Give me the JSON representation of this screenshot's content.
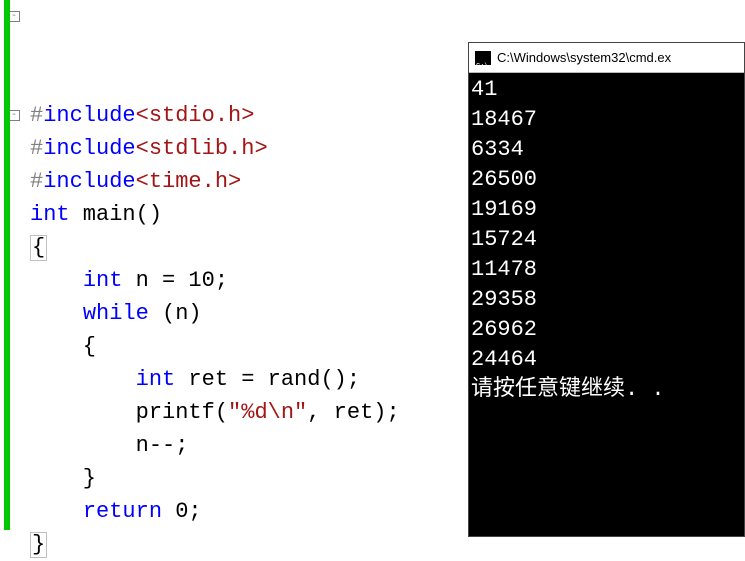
{
  "editor": {
    "lines": [
      {
        "fold": "-",
        "tokens": [
          {
            "cls": "kw-pre",
            "t": "#"
          },
          {
            "cls": "kw-inc",
            "t": "include"
          },
          {
            "cls": "kw-hdr",
            "t": "<stdio.h>"
          }
        ]
      },
      {
        "fold": "",
        "tokens": [
          {
            "cls": "kw-pre",
            "t": "#"
          },
          {
            "cls": "kw-inc",
            "t": "include"
          },
          {
            "cls": "kw-hdr",
            "t": "<stdlib.h>"
          }
        ]
      },
      {
        "fold": "",
        "tokens": [
          {
            "cls": "kw-pre",
            "t": "#"
          },
          {
            "cls": "kw-inc",
            "t": "include"
          },
          {
            "cls": "kw-hdr",
            "t": "<time.h>"
          }
        ]
      },
      {
        "fold": "-",
        "tokens": [
          {
            "cls": "kw-type",
            "t": "int"
          },
          {
            "cls": "plain",
            "t": " main()"
          }
        ]
      },
      {
        "fold": "",
        "tokens": [
          {
            "cls": "plain",
            "t": "{",
            "hl": true
          }
        ]
      },
      {
        "fold": "",
        "tokens": [
          {
            "cls": "plain",
            "t": "    "
          },
          {
            "cls": "kw-type",
            "t": "int"
          },
          {
            "cls": "plain",
            "t": " n = 10;"
          }
        ]
      },
      {
        "fold": "",
        "tokens": [
          {
            "cls": "plain",
            "t": "    "
          },
          {
            "cls": "kw-type",
            "t": "while"
          },
          {
            "cls": "plain",
            "t": " (n)"
          }
        ]
      },
      {
        "fold": "",
        "tokens": [
          {
            "cls": "plain",
            "t": "    {"
          }
        ]
      },
      {
        "fold": "",
        "tokens": [
          {
            "cls": "plain",
            "t": "        "
          },
          {
            "cls": "kw-type",
            "t": "int"
          },
          {
            "cls": "plain",
            "t": " ret = rand();"
          }
        ]
      },
      {
        "fold": "",
        "tokens": [
          {
            "cls": "plain",
            "t": "        printf("
          },
          {
            "cls": "kw-str",
            "t": "\"%d\\n\""
          },
          {
            "cls": "plain",
            "t": ", ret);"
          }
        ]
      },
      {
        "fold": "",
        "tokens": [
          {
            "cls": "plain",
            "t": "        n--;"
          }
        ]
      },
      {
        "fold": "",
        "tokens": [
          {
            "cls": "plain",
            "t": "    }"
          }
        ]
      },
      {
        "fold": "",
        "tokens": [
          {
            "cls": "plain",
            "t": "    "
          },
          {
            "cls": "kw-type",
            "t": "return"
          },
          {
            "cls": "plain",
            "t": " 0;"
          }
        ]
      },
      {
        "fold": "",
        "tokens": [
          {
            "cls": "plain",
            "t": "}",
            "hl": true
          }
        ]
      }
    ]
  },
  "console": {
    "title": "C:\\Windows\\system32\\cmd.ex",
    "output": [
      "41",
      "18467",
      "6334",
      "26500",
      "19169",
      "15724",
      "11478",
      "29358",
      "26962",
      "24464",
      "请按任意键继续. ."
    ]
  }
}
